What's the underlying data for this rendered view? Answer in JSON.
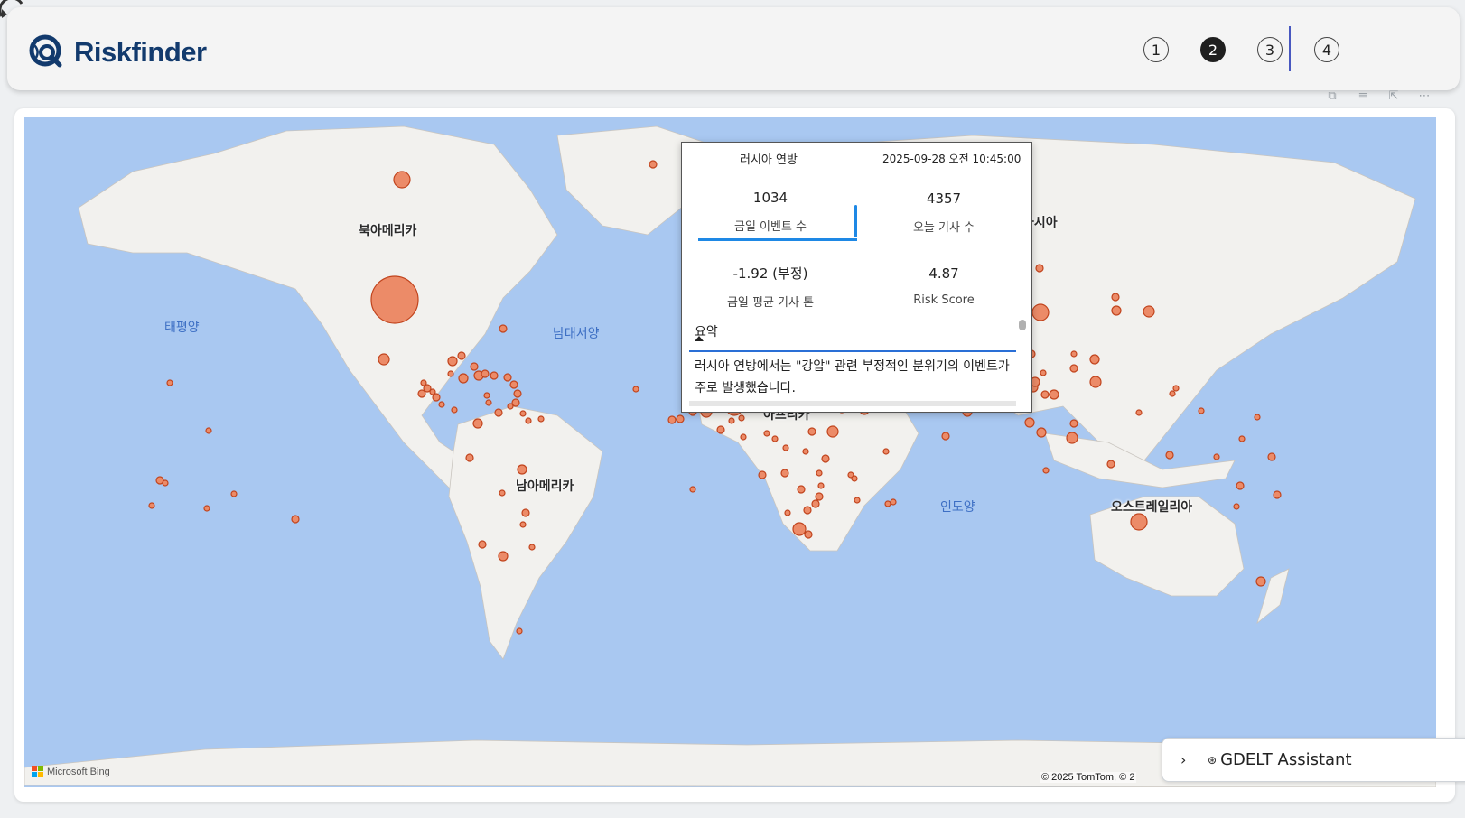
{
  "app": {
    "title": "Riskfinder"
  },
  "pages": [
    {
      "label": "1",
      "active": false
    },
    {
      "label": "2",
      "active": true
    },
    {
      "label": "3",
      "active": false
    },
    {
      "label": "4",
      "active": false
    }
  ],
  "map": {
    "continents": {
      "north_america": "북아메리카",
      "south_america": "남아메리카",
      "africa": "아프리카",
      "asia": "아시아",
      "australia": "오스트레일리아"
    },
    "oceans": {
      "pacific": "태평양",
      "atlantic": "남대서양",
      "indian": "인도양"
    },
    "attribution": {
      "provider": "Microsoft Bing",
      "copyright": "© 2025 TomTom, © 2"
    },
    "colors": {
      "ocean": "#a9c8f1",
      "land": "#f2f1ee",
      "bubble_fill": "#ec8b68",
      "bubble_stroke": "#c1441d"
    }
  },
  "tooltip": {
    "country": "러시아 연방",
    "datetime": "2025-09-28 오전 10:45:00",
    "events_today": {
      "value": "1034",
      "label": "금일 이벤트 수"
    },
    "articles_today": {
      "value": "4357",
      "label": "오늘 기사 수"
    },
    "avg_tone": {
      "value": "-1.92 (부정)",
      "label": "금일 평균 기사 톤"
    },
    "risk_score": {
      "value": "4.87",
      "label": "Risk Score"
    },
    "summary_title": "요약",
    "summary_text": "러시아 연방에서는 \"강압\" 관련 부정적인 분위기의 이벤트가 주로 발생했습니다."
  },
  "assistant": {
    "icon": "gdelt-logo-icon",
    "title": "GDELT Assistant"
  },
  "toolbar": [
    "copy-icon",
    "filter-icon",
    "focus-mode-icon",
    "more-options-icon"
  ]
}
